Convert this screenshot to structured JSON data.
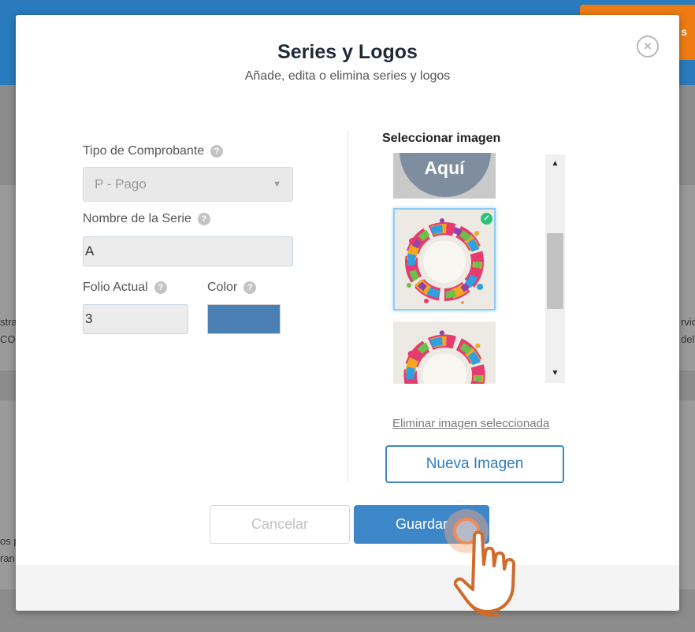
{
  "background": {
    "orange_button_text": "s",
    "left_fragments": [
      "stra",
      "CO",
      "os p",
      "ran"
    ],
    "right_fragments": [
      "rvic",
      "del"
    ]
  },
  "modal": {
    "title": "Series y Logos",
    "subtitle": "Añade, edita o elimina series y logos",
    "close_icon": "×"
  },
  "form": {
    "tipo_label": "Tipo de Comprobante",
    "tipo_value": "P - Pago",
    "serie_label": "Nombre de la Serie",
    "serie_value": "A",
    "folio_label": "Folio Actual",
    "folio_value": "3",
    "color_label": "Color",
    "color_value": "#4a7fb3",
    "help_glyph": "?"
  },
  "images": {
    "title": "Seleccionar imagen",
    "placeholder_text": "Aquí",
    "delete_link": "Eliminar imagen seleccionada",
    "new_button": "Nueva Imagen"
  },
  "footer": {
    "cancel": "Cancelar",
    "save": "Guardar"
  }
}
